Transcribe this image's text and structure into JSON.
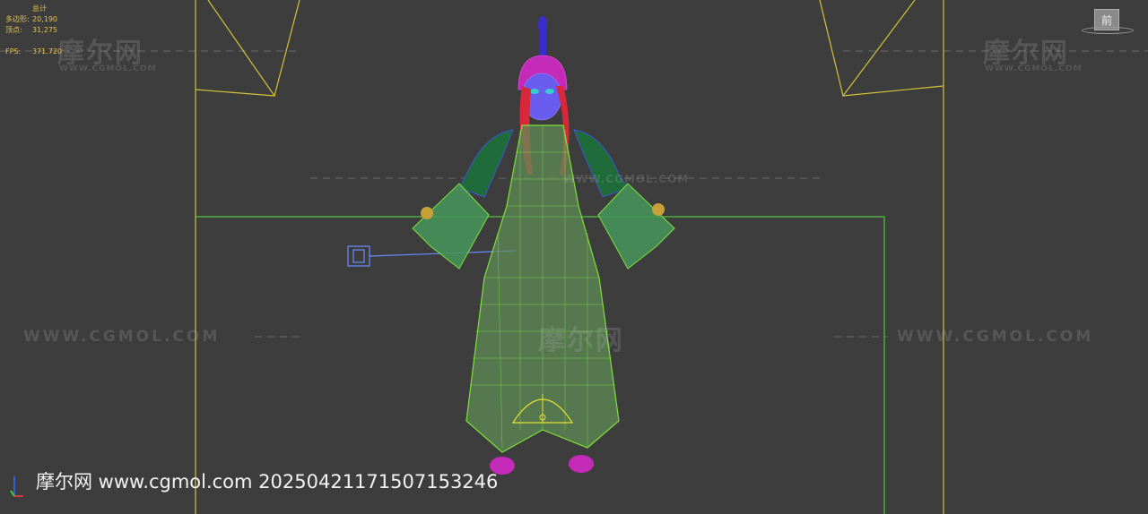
{
  "stats": {
    "header": "总计",
    "polygons_label": "多边形:",
    "polygons_value": "20,190",
    "vertices_label": "顶点:",
    "vertices_value": "31,275",
    "fps_label": "FPS:",
    "fps_value": "371.720"
  },
  "watermark": {
    "brand": "摩尔网",
    "url": "WWW.CGMOL.COM",
    "url_wide": "WWW.CGMOL.COM"
  },
  "viewcube": {
    "face_label": "前"
  },
  "footer": {
    "text": "摩尔网 www.cgmol.com 20250421171507153246"
  },
  "colors": {
    "background": "#3d3d3d",
    "camera_lines": "#d4c23a",
    "ground_box": "#4ec63a",
    "body_wire": "#7fe03a",
    "hair": "#d8283a",
    "head": "#6b5cf0",
    "hat": "#cc22cc",
    "helper": "#6b8cff"
  }
}
